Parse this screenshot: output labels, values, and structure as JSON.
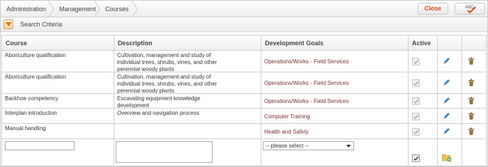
{
  "breadcrumb": [
    "Administration",
    "Management",
    "Courses"
  ],
  "toolbar": {
    "close_label": "Close",
    "spell_label": "ABC"
  },
  "search": {
    "label": "Search Criteria"
  },
  "columns": {
    "course": "Course",
    "description": "Description",
    "goals": "Development Goals",
    "active": "Active"
  },
  "rows": [
    {
      "course": "Aboriculture qualification",
      "description": "Cultivation, management and study of individual trees, shrubs, vines, and other perennial woody plants",
      "goal": "Operations/Works - Field Services",
      "active": true
    },
    {
      "course": "Aboriculture qualification",
      "description": "Cultivation, management and study of individual trees, shrubs, vines, and other perennial woody plants",
      "goal": "Operations/Works - Field Services",
      "active": true
    },
    {
      "course": "Backhoe competency",
      "description": "Excavating equipment knowledge development",
      "goal": "Operations/Works - Field Services",
      "active": true
    },
    {
      "course": "Interplan introduction",
      "description": "Overview and navigation process",
      "goal": "Computer Training",
      "active": true
    },
    {
      "course": "Manual handling",
      "description": "",
      "goal": "Health and Safety",
      "active": true
    }
  ],
  "new_row": {
    "course_value": "",
    "description_value": "",
    "goal_select": "-- please select --",
    "active": true
  },
  "colors": {
    "accent": "#d9480f",
    "goal_text": "#7a2b2b",
    "pencil": "#3f7fbf",
    "trash": "#8a6a3a"
  },
  "icons": {
    "edit": "pencil-icon",
    "delete": "trash-icon",
    "add": "folder-add-icon",
    "spell": "spellcheck-icon",
    "toggle": "chevron-down-icon"
  }
}
